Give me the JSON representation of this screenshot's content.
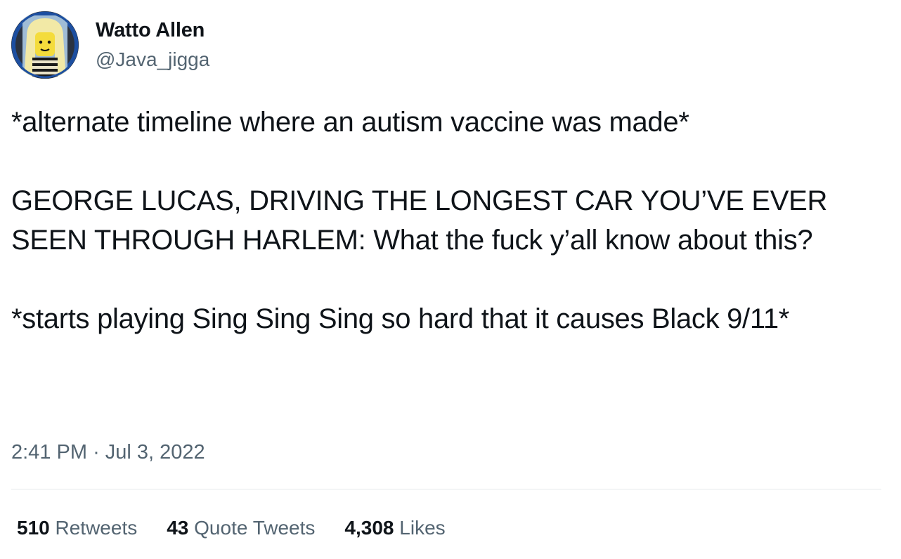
{
  "author": {
    "display_name": "Watto Allen",
    "handle": "@Java_jigga",
    "avatar_icon": "lego-minifigure-avatar"
  },
  "tweet": {
    "text": "*alternate timeline where an autism vaccine was made*\n\nGEORGE LUCAS, DRIVING THE LONGEST CAR YOU’VE EVER SEEN THROUGH HARLEM: What the fuck y’all know about this?\n\n*starts playing Sing Sing Sing so hard that it causes Black 9/11*",
    "time": "2:41 PM",
    "separator": "·",
    "date": "Jul 3, 2022"
  },
  "stats": {
    "retweets": {
      "count": "510",
      "label": "Retweets"
    },
    "quote_tweets": {
      "count": "43",
      "label": "Quote Tweets"
    },
    "likes": {
      "count": "4,308",
      "label": "Likes"
    }
  },
  "colors": {
    "text_primary": "#0f1419",
    "text_secondary": "#536471",
    "divider": "#e6e9eb",
    "avatar_ring": "#1d4fa0"
  }
}
